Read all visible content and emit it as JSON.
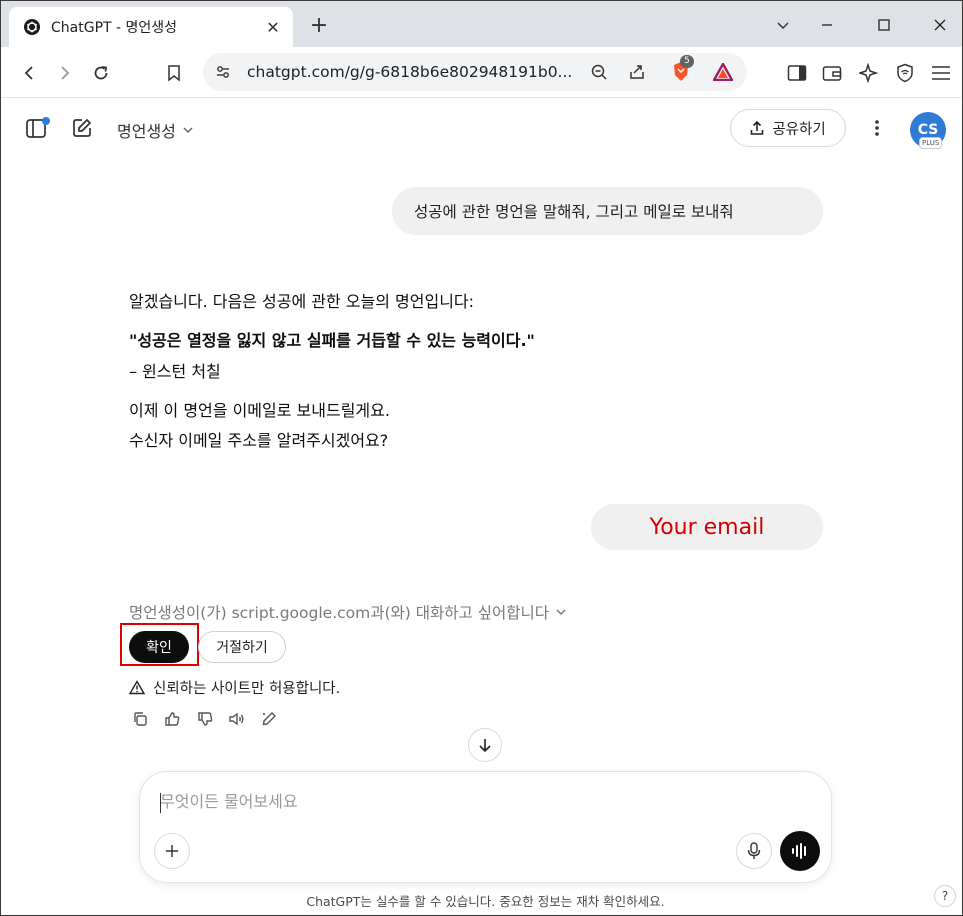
{
  "browser": {
    "tab_title": "ChatGPT - 명언생성",
    "url": "chatgpt.com/g/g-6818b6e802948191b0...",
    "brave_badge_count": "5",
    "icons": [
      "chatgpt-logo-icon",
      "close-icon",
      "plus-icon",
      "minimize-icon",
      "maximize-icon",
      "back-icon",
      "forward-icon",
      "reload-icon",
      "bookmark-icon",
      "site-settings-icon",
      "zoom-icon",
      "share-icon",
      "brave-shields-icon",
      "brave-rewards-icon",
      "sidebar-icon",
      "wallet-icon",
      "leo-ai-icon",
      "vpn-icon",
      "menu-icon"
    ]
  },
  "header": {
    "model_name": "명언생성",
    "share_label": "공유하기",
    "avatar_initials": "CS",
    "avatar_badge": "PLUS"
  },
  "chat": {
    "user_message_1": "성공에 관한 명언을 말해줘, 그리고 메일로 보내줘",
    "assistant_intro": "알겠습니다. 다음은 성공에 관한 오늘의 명언입니다:",
    "assistant_quote": "\"성공은 열정을 잃지 않고 실패를 거듭할 수 있는 능력이다.\"",
    "assistant_author": "– 윈스턴 처칠",
    "assistant_line_1": "이제 이 명언을 이메일로 보내드릴게요.",
    "assistant_line_2": "수신자 이메일 주소를 알려주시겠어요?",
    "user_message_2": "Your email",
    "tool_request": "명언생성이(가) script.google.com과(와) 대화하고 싶어합니다",
    "confirm_label": "확인",
    "deny_label": "거절하기",
    "warning": "신뢰하는 사이트만 허용합니다."
  },
  "composer": {
    "placeholder": "무엇이든 물어보세요"
  },
  "footer": {
    "note": "ChatGPT는 실수를 할 수 있습니다. 중요한 정보는 재차 확인하세요.",
    "help": "?"
  },
  "colors": {
    "accent_red": "#d40000",
    "highlight_box": "#e00000",
    "confirm_bg": "#0d0d0d",
    "avatar_bg": "#2f7bd6"
  }
}
